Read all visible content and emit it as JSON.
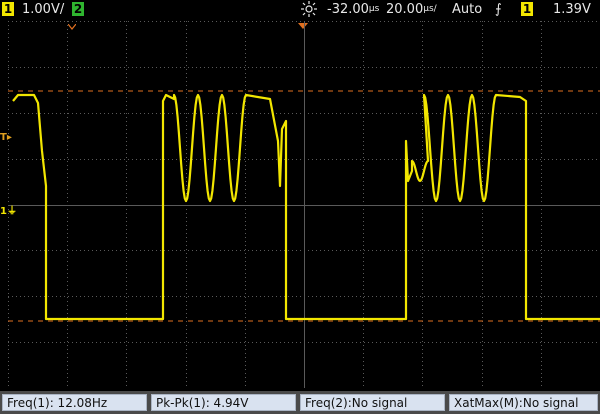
{
  "top_bar": {
    "ch1_badge": "1",
    "ch1_scale": "1.00V/",
    "ch2_badge": "2",
    "trigger_delay": "-32.00",
    "trigger_delay_unit": "µs",
    "time_scale": "20.00",
    "time_scale_unit": "µs/",
    "trigger_mode": "Auto",
    "trigger_slope_symbol": "⨍",
    "trigger_source_badge": "1",
    "trigger_level": "1.39V"
  },
  "markers": {
    "ch1_ground": "1",
    "trigger_level": "T"
  },
  "measurements": [
    {
      "label": "Freq(1): 12.08Hz"
    },
    {
      "label": "Pk-Pk(1): 4.94V"
    },
    {
      "label": "Freq(2):No signal"
    },
    {
      "label": "XatMax(M):No signal"
    }
  ],
  "colors": {
    "ch1": "#f2e600",
    "ch2": "#2fb52f",
    "cursor": "#e07020",
    "grid": "#5a5a5a",
    "trigger_marker": "#e0a020"
  },
  "icons": [
    "sun-icon",
    "trigger-slope-icon",
    "trigger-marker-icon"
  ]
}
